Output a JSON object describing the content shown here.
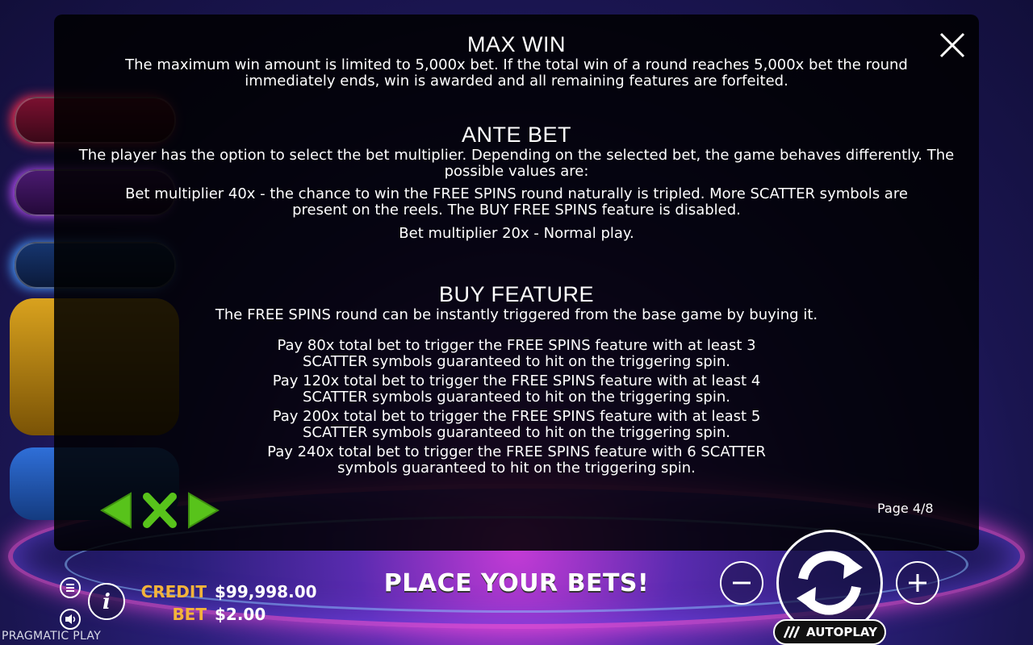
{
  "game": {
    "brand": "PRAGMATIC PLAY"
  },
  "modal": {
    "page_indicator": "Page 4/8",
    "sections": {
      "max_win": {
        "title": "MAX WIN",
        "body": "The maximum win amount is limited to 5,000x bet. If the total win of a round reaches 5,000x bet the round immediately ends, win is awarded and all remaining features are forfeited."
      },
      "ante_bet": {
        "title": "ANTE BET",
        "intro": "The player has the option to select the bet multiplier. Depending on the selected bet, the game behaves differently. The possible values are:",
        "option_1": "Bet multiplier 40x - the chance to win the FREE SPINS round naturally is tripled. More SCATTER symbols are present on the reels. The BUY FREE SPINS feature is disabled.",
        "option_2": "Bet multiplier 20x - Normal play."
      },
      "buy_feature": {
        "title": "BUY FEATURE",
        "intro": "The FREE SPINS round can be instantly triggered from the base game by buying it.",
        "items": [
          "Pay 80x total bet to trigger the FREE SPINS feature with at least 3 SCATTER symbols guaranteed to hit on the triggering spin.",
          "Pay 120x total bet to trigger the FREE SPINS feature with at least 4 SCATTER symbols guaranteed to hit on the triggering spin.",
          "Pay 200x total bet to trigger the FREE SPINS feature with at least 5 SCATTER symbols guaranteed to hit on the triggering spin.",
          "Pay 240x total bet to trigger the FREE SPINS feature with 6 SCATTER symbols guaranteed to hit on the triggering spin."
        ]
      }
    },
    "icons": {
      "close": "close-icon",
      "prev": "arrow-left-icon",
      "exit": "x-icon",
      "next": "arrow-right-icon"
    }
  },
  "hud": {
    "credit_label": "CREDIT",
    "credit_value": "$99,998.00",
    "bet_label": "BET",
    "bet_value": "$2.00",
    "status_message": "PLACE YOUR BETS!",
    "autoplay_label": "AUTOPLAY"
  },
  "colors": {
    "accent_green": "#58c31b",
    "label_gold": "#f4b33a"
  }
}
